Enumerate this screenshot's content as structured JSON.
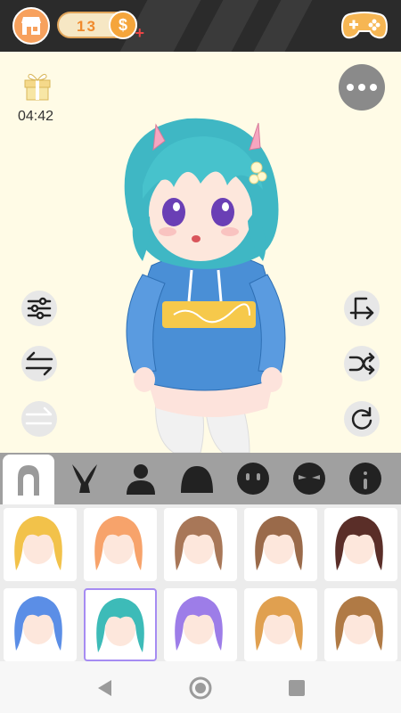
{
  "header": {
    "coins": "13",
    "coin_symbol": "$",
    "coin_plus": "+"
  },
  "canvas": {
    "timer": "04:42"
  },
  "tabs": [
    {
      "icon": "hair-icon",
      "active": true
    },
    {
      "icon": "bunny-ears-icon"
    },
    {
      "icon": "body-icon"
    },
    {
      "icon": "head-shape-icon"
    },
    {
      "icon": "eyes-icon"
    },
    {
      "icon": "brows-icon"
    },
    {
      "icon": "mouth-icon"
    }
  ],
  "hair_items": [
    {
      "color": "#f2c24a"
    },
    {
      "color": "#f7a36b"
    },
    {
      "color": "#a87758"
    },
    {
      "color": "#9a6a4a"
    },
    {
      "color": "#5a2e28"
    },
    {
      "color": "#5b8ee6"
    },
    {
      "color": "#3dbbb8",
      "selected": true
    },
    {
      "color": "#9d7de8"
    },
    {
      "color": "#e0a050"
    },
    {
      "color": "#b07a45"
    }
  ],
  "colors": {
    "topbar": "#2b2b2b",
    "canvas_bg": "#fffbe6",
    "shop_orange": "#f7a15d",
    "coin_text": "#f08a2c",
    "selected_border": "#a68cf2"
  }
}
